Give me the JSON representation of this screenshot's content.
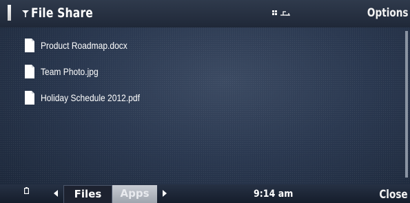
{
  "header": {
    "title": "File Share",
    "options_label": "Options",
    "signal_icon": "signal-strength-icon",
    "network_icon": "network-antenna-icon",
    "status_icons": [
      "grid-apps-icon",
      "usb-connection-icon"
    ]
  },
  "files": [
    {
      "name": "Product Roadmap.docx",
      "icon": "document-icon"
    },
    {
      "name": "Team Photo.jpg",
      "icon": "document-icon"
    },
    {
      "name": "Holiday Schedule 2012.pdf",
      "icon": "document-icon"
    }
  ],
  "footer": {
    "tabs": [
      {
        "label": "Files",
        "active": true
      },
      {
        "label": "Apps",
        "active": false
      }
    ],
    "time": "9:14 am",
    "close_label": "Close",
    "battery_icon": "battery-icon"
  },
  "colors": {
    "background": "#2a3850",
    "bar": "#1f2838",
    "text": "#ffffff",
    "inactive_tab": "#b4b9c1"
  }
}
